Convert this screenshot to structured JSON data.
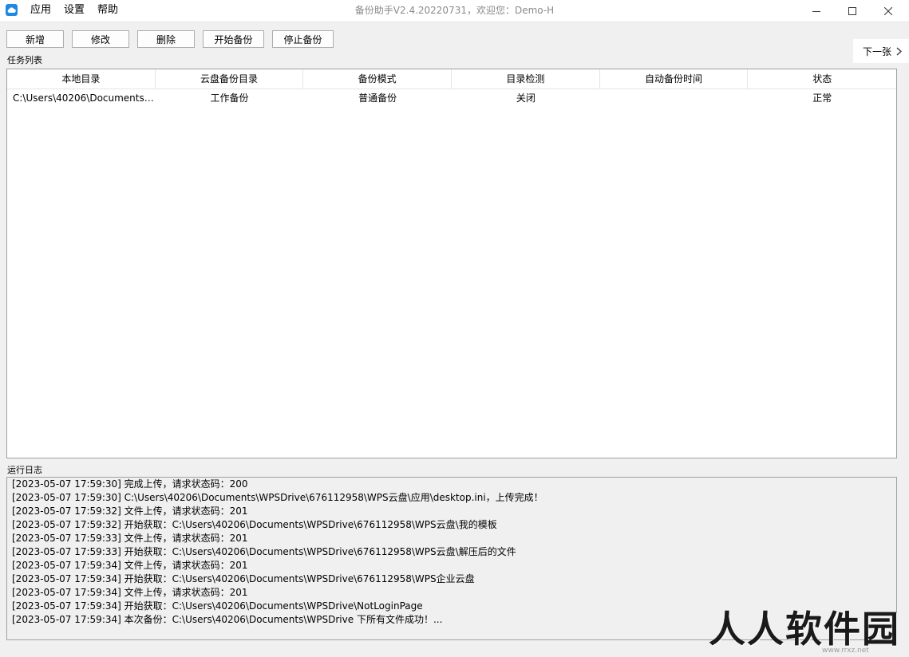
{
  "window": {
    "title": "备份助手V2.4.20220731，欢迎您：Demo-H"
  },
  "menu": {
    "items": [
      {
        "label": "应用"
      },
      {
        "label": "设置"
      },
      {
        "label": "帮助"
      }
    ]
  },
  "toolbar": {
    "add_label": "新增",
    "edit_label": "修改",
    "delete_label": "删除",
    "start_label": "开始备份",
    "stop_label": "停止备份"
  },
  "next_page": {
    "label": "下一张"
  },
  "task_list": {
    "title": "任务列表",
    "columns": [
      "本地目录",
      "云盘备份目录",
      "备份模式",
      "目录检测",
      "自动备份时间",
      "状态"
    ],
    "rows": [
      [
        "C:\\Users\\40206\\Documents\\...",
        "工作备份",
        "普通备份",
        "关闭",
        "",
        "正常"
      ]
    ]
  },
  "log": {
    "title": "运行日志",
    "lines": [
      "[2023-05-07 17:59:30] 完成上传，请求状态码：200",
      "[2023-05-07 17:59:30] C:\\Users\\40206\\Documents\\WPSDrive\\676112958\\WPS云盘\\应用\\desktop.ini，上传完成！",
      "[2023-05-07 17:59:32] 文件上传，请求状态码：201",
      "[2023-05-07 17:59:32] 开始获取：C:\\Users\\40206\\Documents\\WPSDrive\\676112958\\WPS云盘\\我的模板",
      "[2023-05-07 17:59:33] 文件上传，请求状态码：201",
      "[2023-05-07 17:59:33] 开始获取：C:\\Users\\40206\\Documents\\WPSDrive\\676112958\\WPS云盘\\解压后的文件",
      "[2023-05-07 17:59:34] 文件上传，请求状态码：201",
      "[2023-05-07 17:59:34] 开始获取：C:\\Users\\40206\\Documents\\WPSDrive\\676112958\\WPS企业云盘",
      "[2023-05-07 17:59:34] 文件上传，请求状态码：201",
      "[2023-05-07 17:59:34] 开始获取：C:\\Users\\40206\\Documents\\WPSDrive\\NotLoginPage",
      "[2023-05-07 17:59:34] 本次备份：C:\\Users\\40206\\Documents\\WPSDrive 下所有文件成功！..."
    ]
  },
  "watermark": {
    "text": "人人软件园",
    "sub": "www.rrxz.net"
  },
  "icons": {
    "app": "cloud-icon",
    "next": "chevron-right-icon"
  },
  "colors": {
    "app_icon": "#1e88e5",
    "title_text": "#8a8a8a",
    "border": "#a0a0a0"
  }
}
